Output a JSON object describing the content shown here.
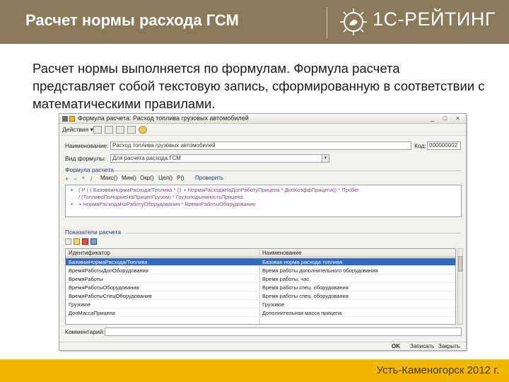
{
  "slide": {
    "title": "Расчет нормы расхода ГСМ",
    "brand": "1С-РЕЙТИНГ",
    "intro": "Расчет нормы выполняется по формулам. Формула расчета представляет собой текстовую запись, сформированную в соответствии с математическими правилами.",
    "footer": "Усть-Каменогорск 2012 г."
  },
  "form": {
    "window_title": "Формула расчета: Расход топлива грузовых автомобилей",
    "window_controls": "_ □ ×",
    "actions_label": "Действия ▾",
    "name_label": "Наименование:",
    "name_value": "Расход топлива грузовых автомобилей",
    "code_label": "Код:",
    "code_value": "000000002",
    "formula_type_label": "Вид формулы:",
    "formula_type_value": "Для расчета расхода ГСМ",
    "formula_section": "Формула расчета",
    "formula_toolbar": [
      "Макс()",
      "Мин()",
      "Окр()",
      "Цел()",
      "Р()",
      "Проверить"
    ],
    "formula_lines": [
      "( Р ( ( БазоваяНормаРасхода/Топлива * (1 + НормаРасходаНаДопРаботуПрицепа * ДопКоэффПрицепа)) * Пробег",
      "/ (ТопливоПоНормеНаПрицепГрузом) * ГрузоподъемностьПрицепа",
      "+ НормаРасходаНаРаботуОборудования * ВремяРаботыОборудования"
    ],
    "params_section": "Показатели расчета",
    "table": {
      "headers": [
        "Идентификатор",
        "Наименование"
      ],
      "rows": [
        [
          "БазоваяНормаРасхода/Топлива",
          "Базовая норма расхода топлива"
        ],
        [
          "ВремяРаботыДопОборудования",
          "Время работы дополнительного оборудования"
        ],
        [
          "ВремяРаботы",
          "Время работы, час"
        ],
        [
          "ВремяРаботыОборудования",
          "Время работы спец. оборудования"
        ],
        [
          "ВремяРаботыСпецОборудования",
          "Время работы спец. оборудования"
        ],
        [
          "Грузовое",
          "Грузовое"
        ],
        [
          "ДопМассаПрицепа",
          "Дополнительная масса прицепа"
        ]
      ],
      "selected_row": 0
    },
    "comment_label": "Комментарий:",
    "buttons": {
      "ok": "OK",
      "save": "Записать",
      "close": "Закрыть"
    }
  },
  "colors": {
    "header_bg": "#8a7a59",
    "footer_bg": "#f2b800",
    "selection": "#316ac5"
  }
}
